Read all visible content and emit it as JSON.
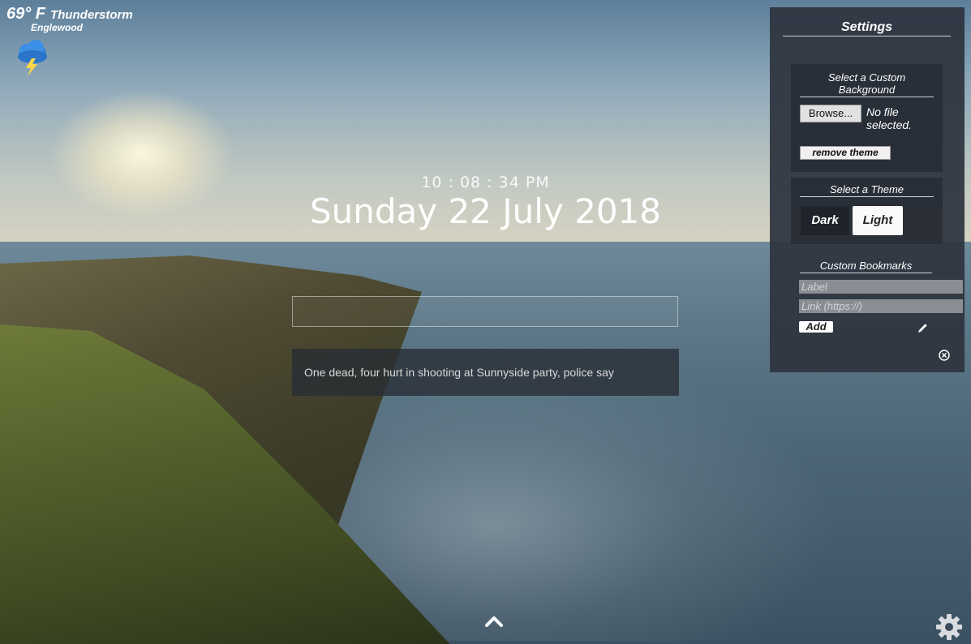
{
  "weather": {
    "temperature": "69° F",
    "condition": "Thunderstorm",
    "location": "Englewood",
    "icon": "thunderstorm-icon"
  },
  "clock": {
    "time": "10 : 08 : 34 PM",
    "date": "Sunday 22 July 2018"
  },
  "search": {
    "value": "",
    "placeholder": ""
  },
  "news": {
    "headline": "One dead, four hurt in shooting at Sunnyside party, police say"
  },
  "settings": {
    "title": "Settings",
    "background": {
      "heading": "Select a Custom Background",
      "browse_label": "Browse...",
      "file_status": "No file selected.",
      "remove_label": "remove theme"
    },
    "theme": {
      "heading": "Select a Theme",
      "options": [
        "Dark",
        "Light"
      ],
      "selected": "Light"
    },
    "bookmarks": {
      "heading": "Custom Bookmarks",
      "label_placeholder": "Label",
      "link_placeholder": "Link (https://)",
      "add_label": "Add"
    }
  },
  "colors": {
    "panel": "#2d343e",
    "accent": "#ffffff"
  }
}
